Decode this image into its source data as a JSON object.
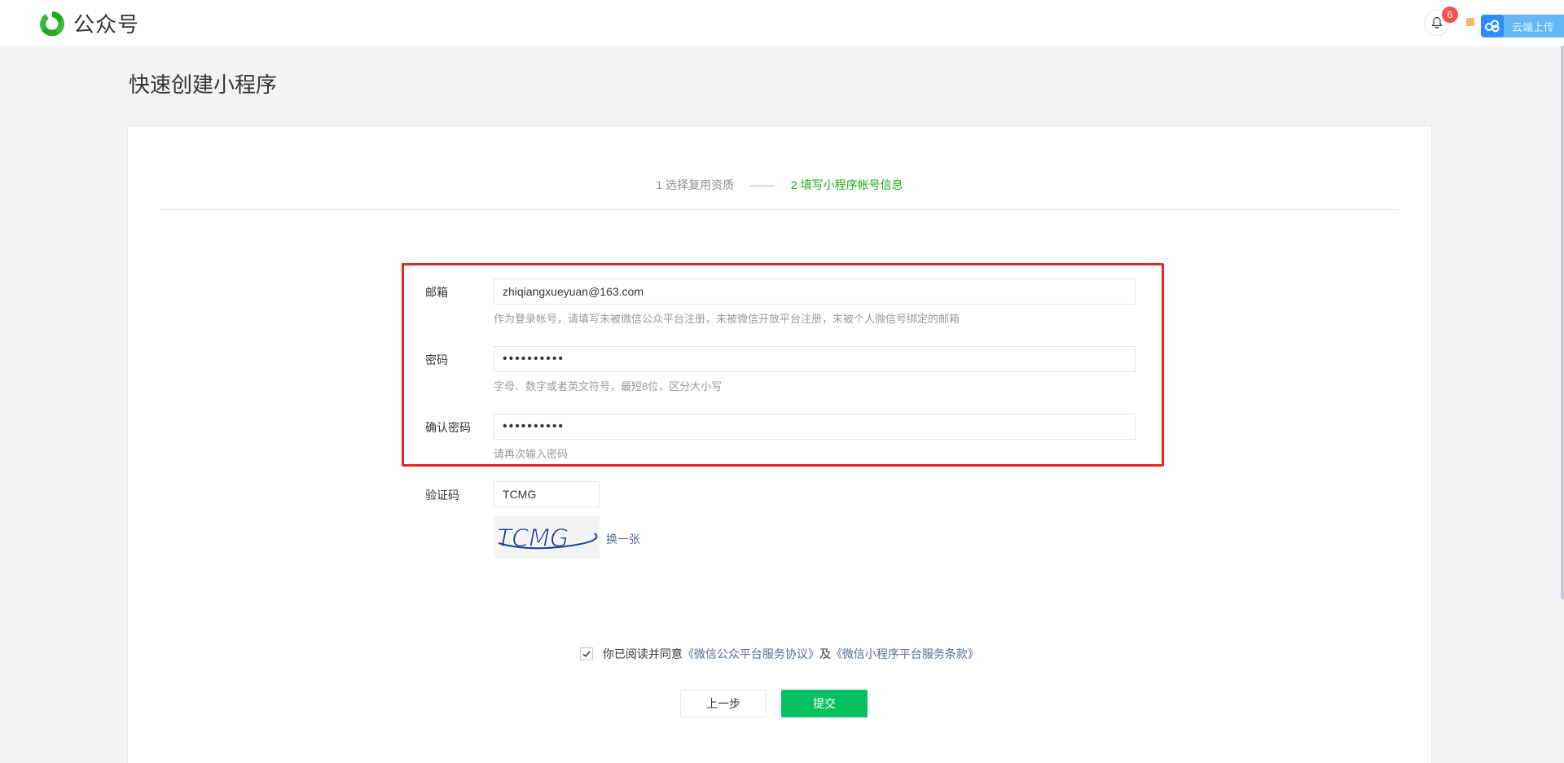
{
  "header": {
    "app_name": "公众号",
    "notification_count": "6",
    "cloud_label": "云端上传"
  },
  "page_title": "快速创建小程序",
  "steps": [
    {
      "label": "1 选择复用资质",
      "active": false
    },
    {
      "label": "2 填写小程序帐号信息",
      "active": true
    }
  ],
  "form": {
    "email": {
      "label": "邮箱",
      "value": "zhiqiangxueyuan@163.com",
      "tip": "作为登录帐号，请填写未被微信公众平台注册，未被微信开放平台注册，未被个人微信号绑定的邮箱"
    },
    "password": {
      "label": "密码",
      "value": "••••••••••",
      "tip": "字母、数字或者英文符号，最短8位，区分大小写"
    },
    "confirm_password": {
      "label": "确认密码",
      "value": "••••••••••",
      "tip": "请再次输入密码"
    },
    "captcha": {
      "label": "验证码",
      "value": "TCMG",
      "image_text": "TCMG",
      "change_label": "换一张"
    }
  },
  "agreement": {
    "prefix": "你已阅读并同意",
    "link1": "《微信公众平台服务协议》",
    "middle": "及",
    "link2": "《微信小程序平台服务条款》",
    "checked": true
  },
  "buttons": {
    "prev_label": "上一步",
    "submit_label": "提交"
  },
  "colors": {
    "accent": "#07c160",
    "active_step": "#1aad19",
    "highlight": "#e82525",
    "link": "#576b95"
  }
}
